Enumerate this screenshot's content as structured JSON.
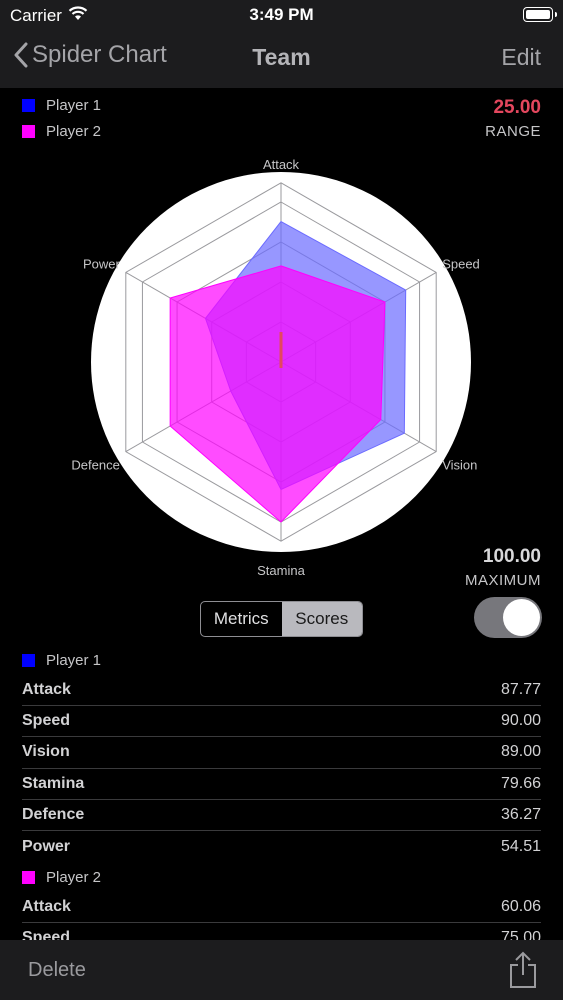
{
  "status_bar": {
    "carrier": "Carrier",
    "time": "3:49 PM"
  },
  "nav": {
    "back_label": "Spider Chart",
    "title": "Team",
    "edit_label": "Edit"
  },
  "legend": [
    {
      "name": "Player 1",
      "color": "#0000ff"
    },
    {
      "name": "Player 2",
      "color": "#ff00ff"
    }
  ],
  "range": {
    "value": "25.00",
    "label": "RANGE"
  },
  "maximum": {
    "value": "100.00",
    "label": "MAXIMUM"
  },
  "chart_data": {
    "type": "radar",
    "axes": [
      "Attack",
      "Speed",
      "Vision",
      "Stamina",
      "Defence",
      "Power"
    ],
    "max": 100,
    "rings": 4,
    "series": [
      {
        "name": "Player 1",
        "color": "#6b6bff",
        "values": [
          87.77,
          90.0,
          89.0,
          79.66,
          36.27,
          54.51
        ]
      },
      {
        "name": "Player 2",
        "color": "#ff00ff",
        "values": [
          60.06,
          75.0,
          72.0,
          100.0,
          80.0,
          80.0
        ]
      }
    ]
  },
  "segmented": {
    "options": [
      "Metrics",
      "Scores"
    ],
    "selected": "Scores"
  },
  "toggle": {
    "on": true
  },
  "scores": [
    {
      "player": "Player 1",
      "color": "#0000ff",
      "rows": [
        {
          "metric": "Attack",
          "score": "87.77"
        },
        {
          "metric": "Speed",
          "score": "90.00"
        },
        {
          "metric": "Vision",
          "score": "89.00"
        },
        {
          "metric": "Stamina",
          "score": "79.66"
        },
        {
          "metric": "Defence",
          "score": "36.27"
        },
        {
          "metric": "Power",
          "score": "54.51"
        }
      ]
    },
    {
      "player": "Player 2",
      "color": "#ff00ff",
      "rows": [
        {
          "metric": "Attack",
          "score": "60.06"
        },
        {
          "metric": "Speed",
          "score": "75.00"
        }
      ]
    }
  ],
  "toolbar": {
    "delete_label": "Delete",
    "share_icon": "share-icon"
  }
}
